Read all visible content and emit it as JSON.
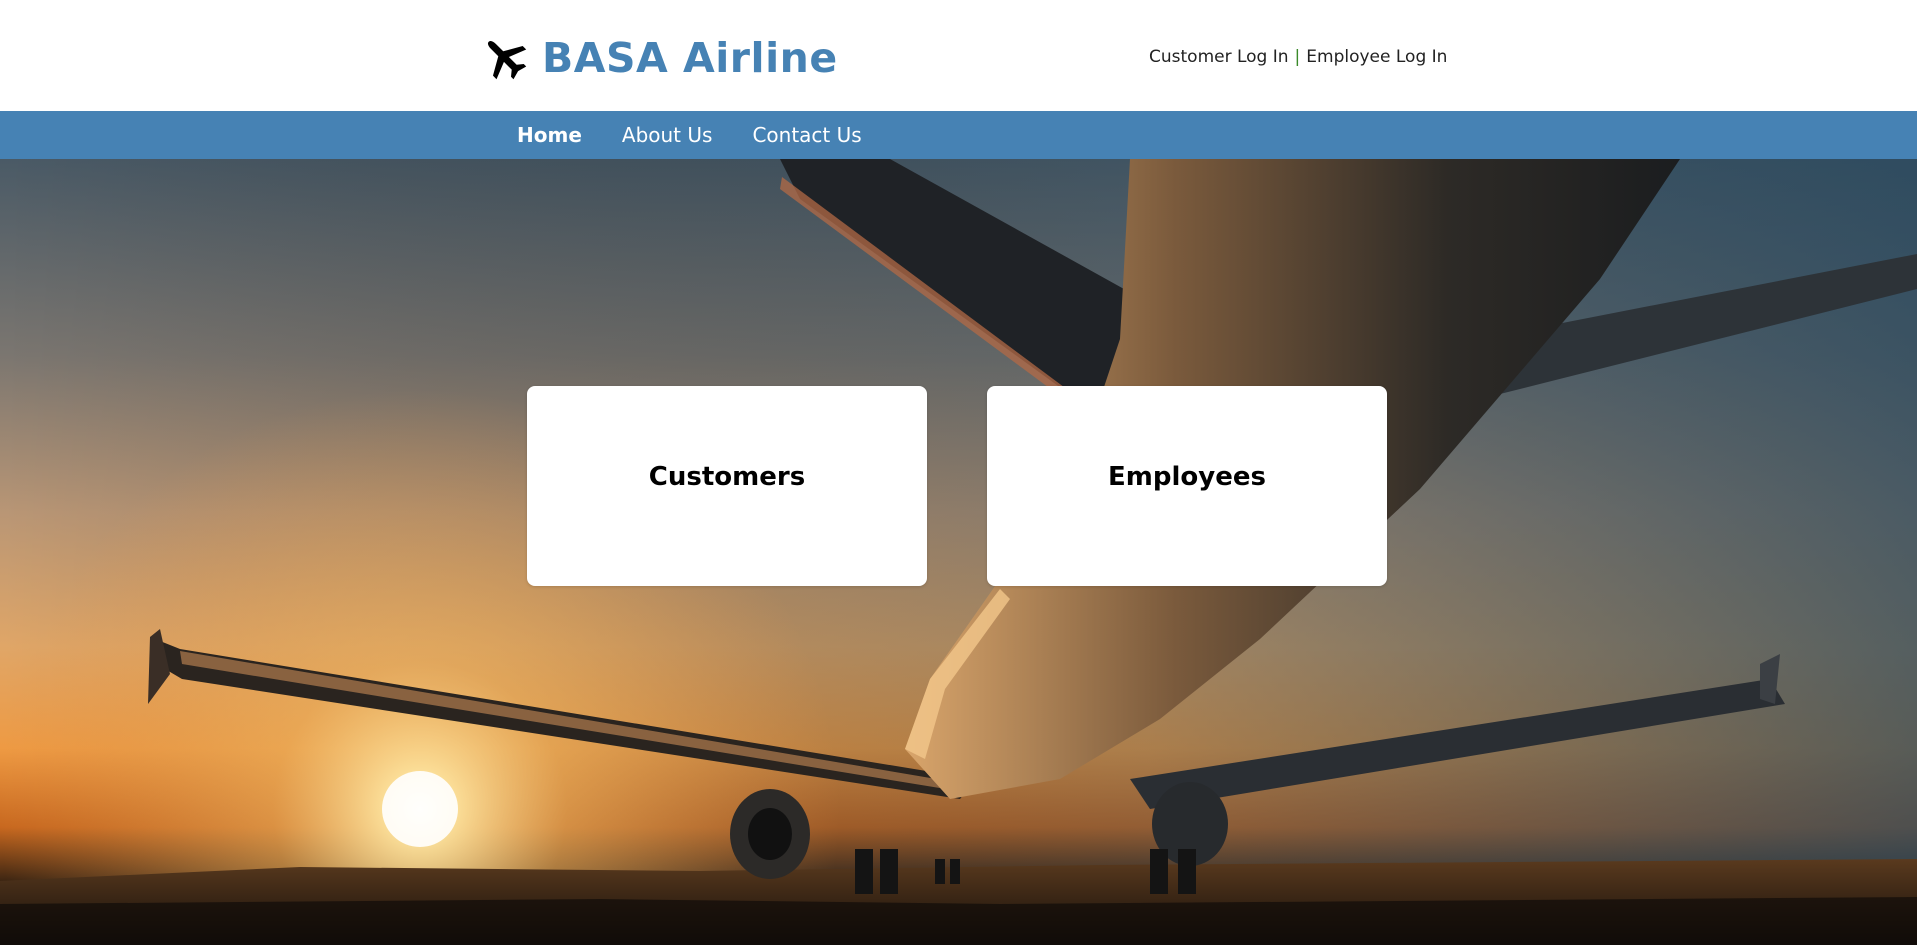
{
  "header": {
    "brand_name": "BASA Airline",
    "brand_icon": "airplane-icon",
    "brand_color": "#4682b4",
    "login": {
      "customer_label": "Customer Log In",
      "separator": "|",
      "employee_label": "Employee Log In"
    }
  },
  "nav": {
    "background": "#4682b4",
    "items": [
      {
        "label": "Home",
        "active": true
      },
      {
        "label": "About Us",
        "active": false
      },
      {
        "label": "Contact Us",
        "active": false
      }
    ]
  },
  "hero": {
    "image": "airplane-at-sunset"
  },
  "cards": {
    "customers_label": "Customers",
    "employees_label": "Employees"
  }
}
